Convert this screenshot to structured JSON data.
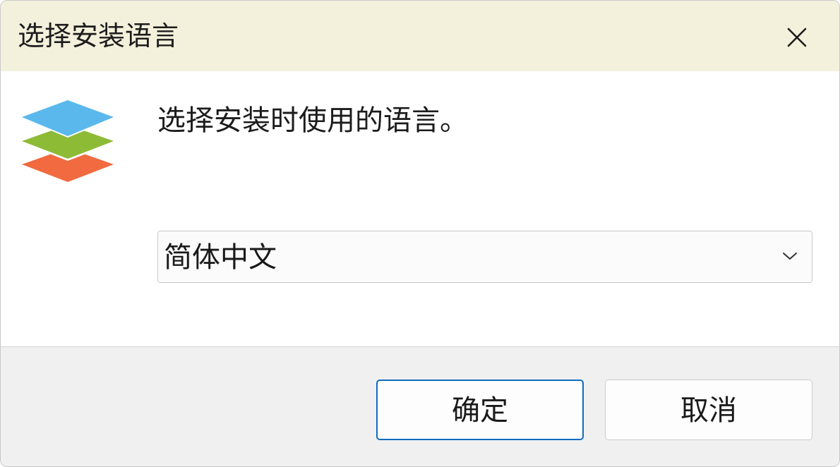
{
  "window": {
    "title": "选择安装语言"
  },
  "content": {
    "prompt": "选择安装时使用的语言。",
    "language_select": {
      "selected": "简体中文"
    }
  },
  "footer": {
    "ok_label": "确定",
    "cancel_label": "取消"
  },
  "icons": {
    "close": "close-icon",
    "dropdown": "chevron-down-icon",
    "logo": "app-logo"
  },
  "colors": {
    "titlebar_bg": "#f3f1dc",
    "footer_bg": "#f0f0f0",
    "accent_border": "#0f6cbd",
    "logo_top": "#5bb8ec",
    "logo_middle": "#8dbb35",
    "logo_bottom": "#f16a40"
  }
}
